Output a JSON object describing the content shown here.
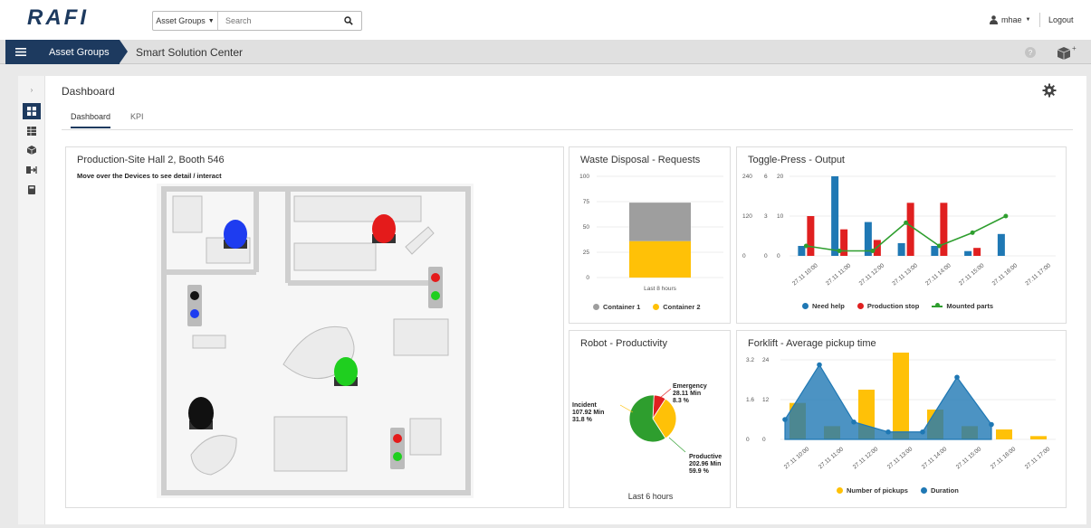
{
  "header": {
    "logo_text": "RAFI",
    "asset_select": "Asset Groups",
    "search_placeholder": "Search",
    "user": "mhae",
    "logout": "Logout"
  },
  "navbar": {
    "breadcrumb": "Asset Groups",
    "title": "Smart Solution Center"
  },
  "page": {
    "title": "Dashboard",
    "tabs": [
      "Dashboard",
      "KPI"
    ]
  },
  "floorplan": {
    "title": "Production-Site Hall 2, Booth 546",
    "hint": "Move over the Devices to see detail / interact",
    "colors": {
      "blue": "#1e3cf0",
      "red": "#e41b1b",
      "green": "#1fcf1f",
      "black": "#111111"
    }
  },
  "waste": {
    "title": "Waste Disposal - Requests",
    "footer": "Last 8 hours",
    "legend": [
      {
        "name": "Container 1",
        "color": "#9e9e9e"
      },
      {
        "name": "Container 2",
        "color": "#ffc107"
      }
    ]
  },
  "toggle": {
    "title": "Toggle-Press - Output",
    "legend": [
      {
        "name": "Need help",
        "color": "#1f78b4"
      },
      {
        "name": "Production stop",
        "color": "#e02020"
      },
      {
        "name": "Mounted parts",
        "color": "#2e9e2e"
      }
    ]
  },
  "robot": {
    "title": "Robot - Productivity",
    "footer": "Last 6 hours",
    "labels": {
      "emergency": [
        "Emergency",
        "28.11 Min",
        "8.3 %"
      ],
      "incident": [
        "Incident",
        "107.92 Min",
        "31.8 %"
      ],
      "productive": [
        "Productive",
        "202.96 Min",
        "59.9 %"
      ]
    }
  },
  "forklift": {
    "title": "Forklift - Average pickup time",
    "legend": [
      {
        "name": "Number of pickups",
        "color": "#ffc107"
      },
      {
        "name": "Duration",
        "color": "#1f78b4"
      }
    ]
  },
  "chart_data": [
    {
      "type": "bar",
      "title": "Waste Disposal - Requests",
      "categories": [
        "Last 8 hours"
      ],
      "stacked": true,
      "series": [
        {
          "name": "Container 1",
          "values": [
            38
          ]
        },
        {
          "name": "Container 2",
          "values": [
            36
          ]
        }
      ],
      "ylim": [
        0,
        100
      ],
      "yticks": [
        0,
        25,
        50,
        75,
        100
      ],
      "grid": true,
      "legend": "bottom"
    },
    {
      "type": "bar",
      "title": "Toggle-Press - Output",
      "categories": [
        "27.11 10:00",
        "27.11 11:00",
        "27.11 12:00",
        "27.11 13:00",
        "27.11 14:00",
        "27.11 15:00",
        "27.11 16:00",
        "27.11 17:00"
      ],
      "series": [
        {
          "name": "Need help",
          "axis": "right",
          "values": [
            2.5,
            20,
            8.5,
            3.2,
            2.5,
            1.2,
            5.5,
            0
          ]
        },
        {
          "name": "Production stop",
          "axis": "middle",
          "values": [
            3,
            2,
            1.2,
            4,
            4,
            0.6,
            0,
            0
          ]
        },
        {
          "name": "Mounted parts",
          "type": "line",
          "axis": "left",
          "values": [
            30,
            15,
            15,
            100,
            30,
            70,
            120,
            null
          ]
        }
      ],
      "axes": {
        "left": {
          "ticks": [
            0,
            120,
            240
          ],
          "color": "#2e9e2e"
        },
        "middle": {
          "ticks": [
            0,
            3,
            6
          ],
          "color": "#e02020"
        },
        "right": {
          "ticks": [
            0,
            10,
            20
          ],
          "color": "#1f78b4"
        }
      },
      "legend": "bottom"
    },
    {
      "type": "pie",
      "title": "Robot - Productivity",
      "categories": [
        "Emergency",
        "Incident",
        "Productive"
      ],
      "values": [
        28.11,
        107.92,
        202.96
      ],
      "percentages": [
        8.3,
        31.8,
        59.9
      ],
      "colors": [
        "#e02020",
        "#ffc107",
        "#2e9e2e"
      ],
      "subtitle": "Last 6 hours"
    },
    {
      "type": "bar",
      "title": "Forklift - Average pickup time",
      "categories": [
        "27.11 10:00",
        "27.11 11:00",
        "27.11 12:00",
        "27.11 13:00",
        "27.11 14:00",
        "27.11 15:00",
        "27.11 16:00",
        "27.11 17:00"
      ],
      "series": [
        {
          "name": "Number of pickups",
          "axis": "right",
          "values": [
            11,
            4,
            15,
            31,
            9,
            4,
            3,
            1
          ]
        },
        {
          "name": "Duration",
          "type": "area",
          "axis": "left",
          "values": [
            0.8,
            3.0,
            0.7,
            0.3,
            0.3,
            2.5,
            0.6,
            null
          ]
        }
      ],
      "axes": {
        "left": {
          "ticks": [
            0,
            1.6,
            3.2
          ],
          "color": "#1f78b4"
        },
        "right": {
          "ticks": [
            0,
            12,
            24
          ],
          "color": "#e5a800"
        }
      },
      "legend": "bottom"
    }
  ]
}
